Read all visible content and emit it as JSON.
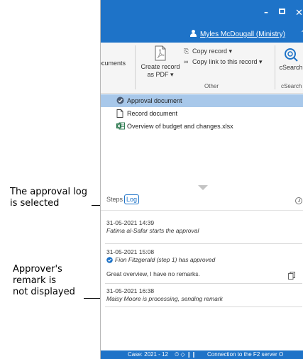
{
  "annotations": {
    "approval_log_selected": "The approval log is selected",
    "remark_line1": "Approver's",
    "remark_line2": "remark is",
    "remark_line3": "not displayed"
  },
  "titlebar": {
    "user": "Myles McDougall (Ministry)",
    "color": "#1e73c8"
  },
  "ribbon": {
    "documents_label": "ocuments",
    "create_pdf_line1": "Create record",
    "create_pdf_line2": "as PDF ▾",
    "copy_record": "Copy record ▾",
    "copy_link": "Copy link to this record ▾",
    "group_other": "Other",
    "csearch_label": "cSearch",
    "csearch_group": "cSearch"
  },
  "documents": [
    {
      "name": "Approval document",
      "icon": "approval-check-icon",
      "selected": true
    },
    {
      "name": "Record document",
      "icon": "document-icon",
      "selected": false
    },
    {
      "name": "Overview of budget and changes.xlsx",
      "icon": "excel-icon",
      "selected": false
    }
  ],
  "tabs": {
    "steps": "Steps",
    "log": "Log"
  },
  "log": [
    {
      "date": "31-05-2021 14:39",
      "text": "Fatima al-Safar starts the approval",
      "check": false,
      "remark": ""
    },
    {
      "date": "31-05-2021 15:08",
      "text": "Fion Fitzgerald (step 1) has approved",
      "check": true,
      "remark": "Great overview, I have no remarks."
    },
    {
      "date": "31-05-2021 16:38",
      "text": "Maisy Moore is processing, sending remark",
      "check": false,
      "remark": ""
    }
  ],
  "statusbar": {
    "case": "Case: 2021 - 12",
    "connection": "Connection to the F2 server O"
  }
}
